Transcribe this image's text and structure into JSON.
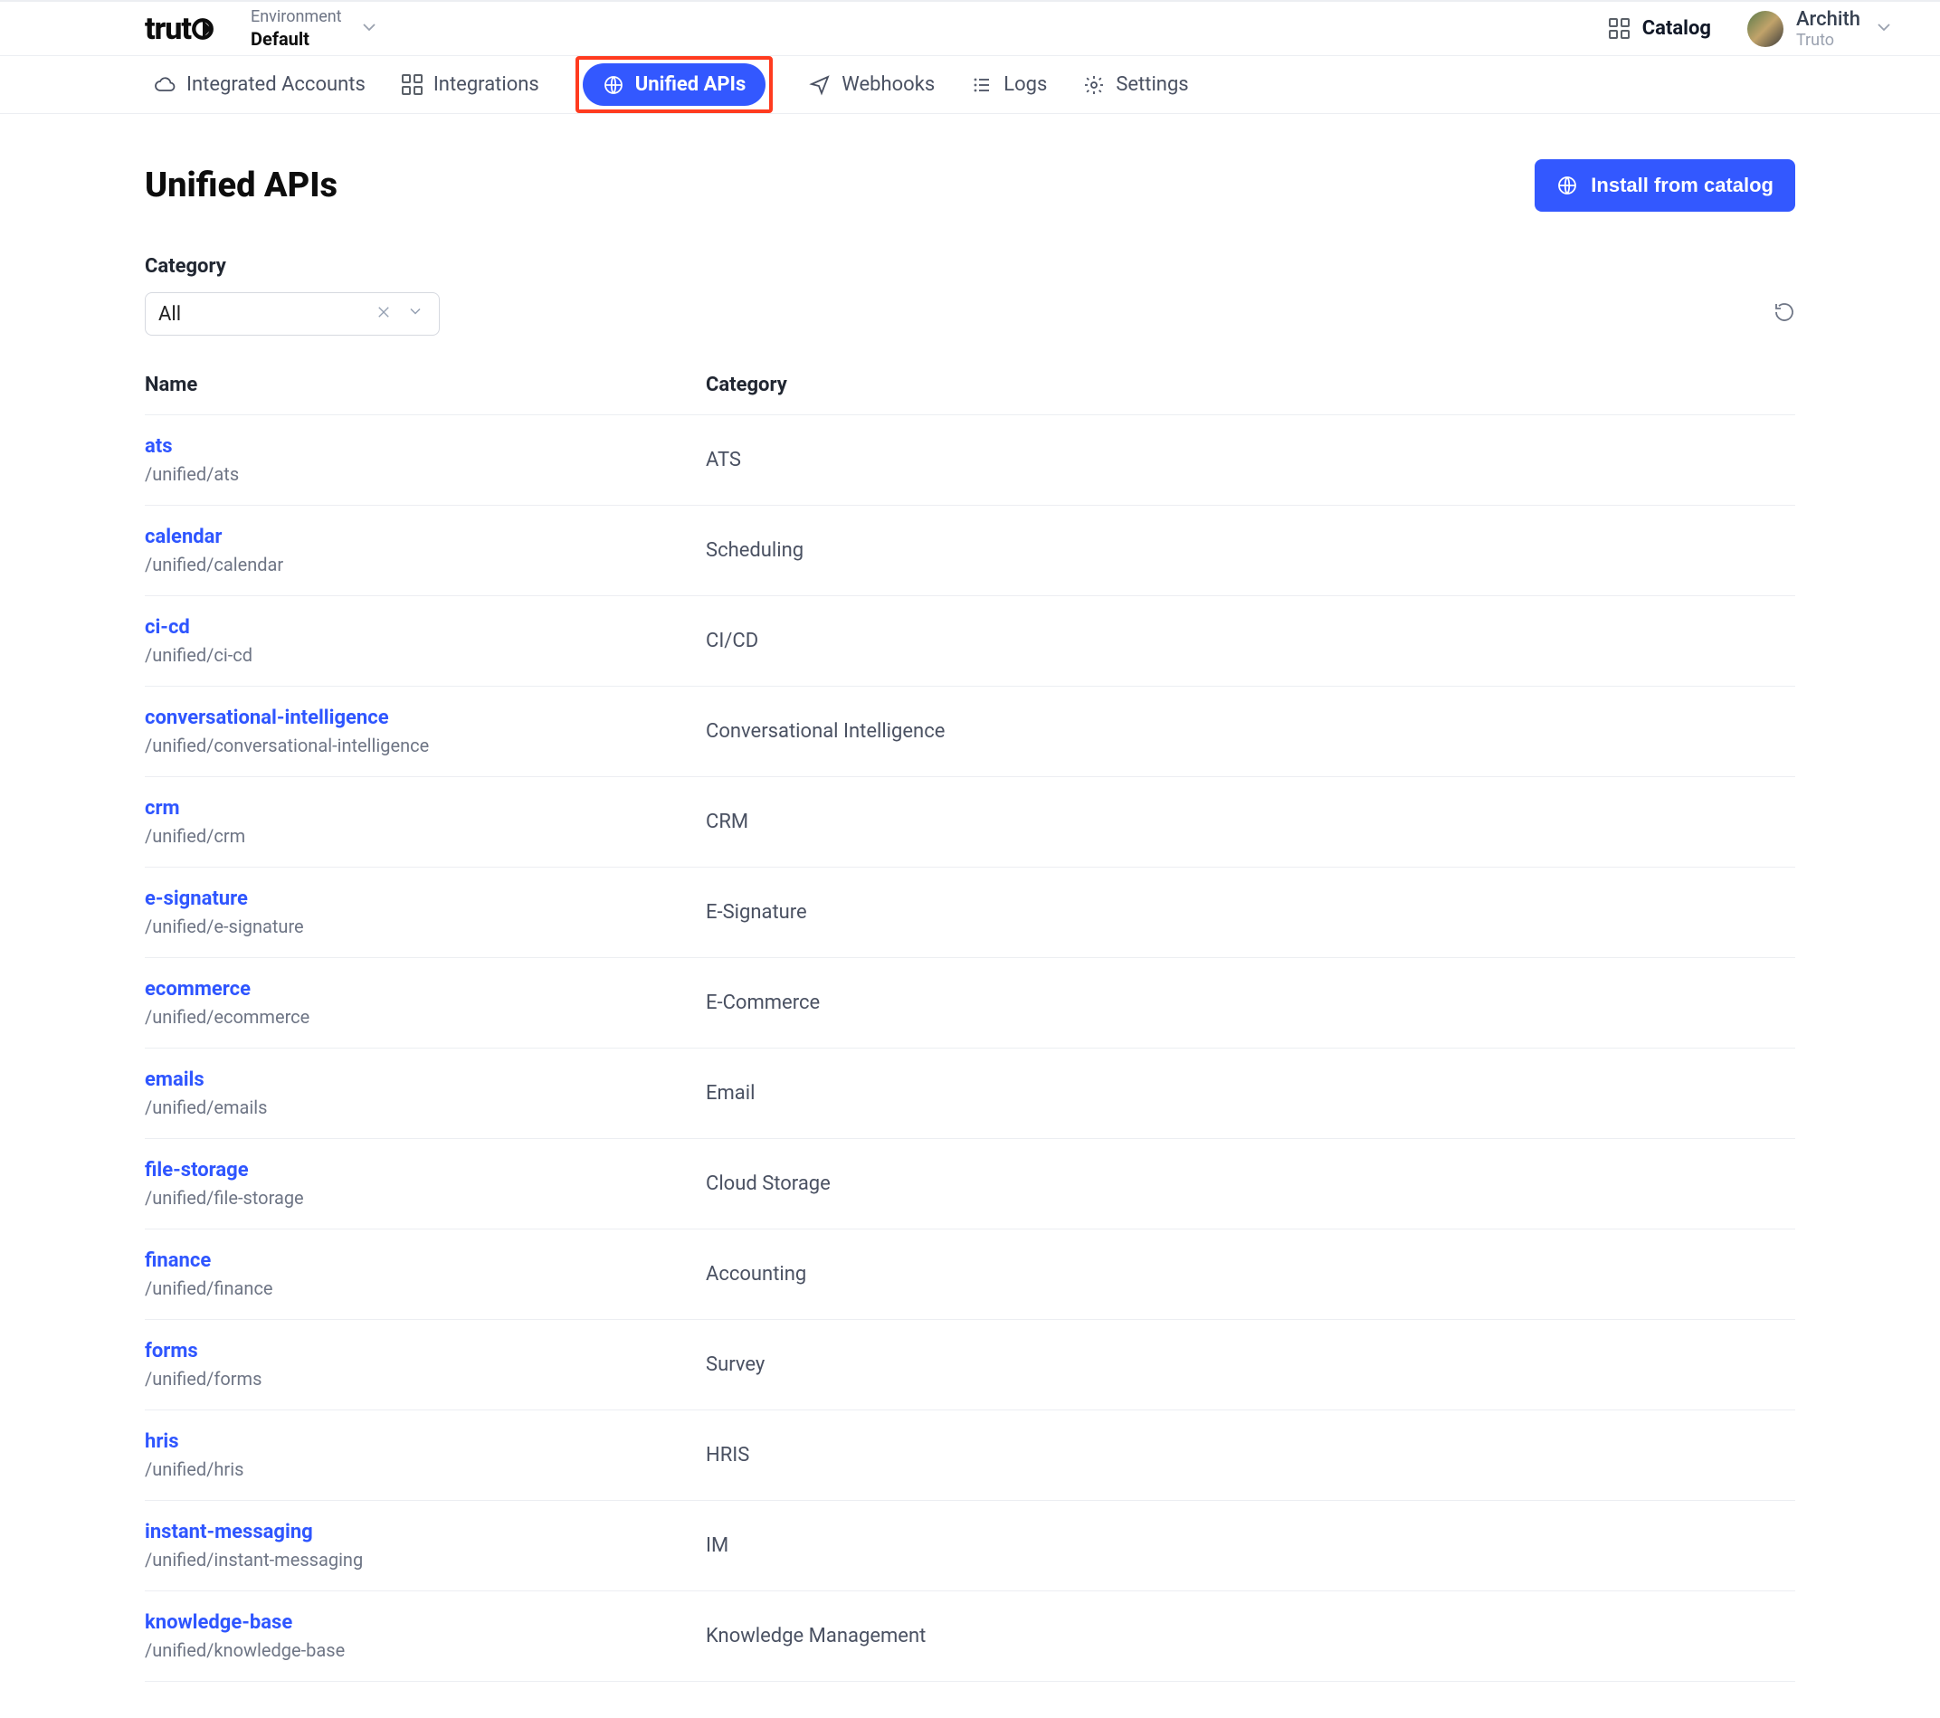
{
  "brand": "truto",
  "environment": {
    "label": "Environment",
    "value": "Default"
  },
  "catalog_label": "Catalog",
  "user": {
    "name": "Archith",
    "org": "Truto"
  },
  "nav": {
    "integrated_accounts": "Integrated Accounts",
    "integrations": "Integrations",
    "unified_apis": "Unified APIs",
    "webhooks": "Webhooks",
    "logs": "Logs",
    "settings": "Settings"
  },
  "page": {
    "title": "Unified APIs",
    "install_button": "Install from catalog",
    "category_label": "Category",
    "category_value": "All"
  },
  "table": {
    "header_name": "Name",
    "header_category": "Category",
    "rows": [
      {
        "name": "ats",
        "path": "/unified/ats",
        "category": "ATS"
      },
      {
        "name": "calendar",
        "path": "/unified/calendar",
        "category": "Scheduling"
      },
      {
        "name": "ci-cd",
        "path": "/unified/ci-cd",
        "category": "CI/CD"
      },
      {
        "name": "conversational-intelligence",
        "path": "/unified/conversational-intelligence",
        "category": "Conversational Intelligence"
      },
      {
        "name": "crm",
        "path": "/unified/crm",
        "category": "CRM"
      },
      {
        "name": "e-signature",
        "path": "/unified/e-signature",
        "category": "E-Signature"
      },
      {
        "name": "ecommerce",
        "path": "/unified/ecommerce",
        "category": "E-Commerce"
      },
      {
        "name": "emails",
        "path": "/unified/emails",
        "category": "Email"
      },
      {
        "name": "file-storage",
        "path": "/unified/file-storage",
        "category": "Cloud Storage"
      },
      {
        "name": "finance",
        "path": "/unified/finance",
        "category": "Accounting"
      },
      {
        "name": "forms",
        "path": "/unified/forms",
        "category": "Survey"
      },
      {
        "name": "hris",
        "path": "/unified/hris",
        "category": "HRIS"
      },
      {
        "name": "instant-messaging",
        "path": "/unified/instant-messaging",
        "category": "IM"
      },
      {
        "name": "knowledge-base",
        "path": "/unified/knowledge-base",
        "category": "Knowledge Management"
      }
    ]
  }
}
